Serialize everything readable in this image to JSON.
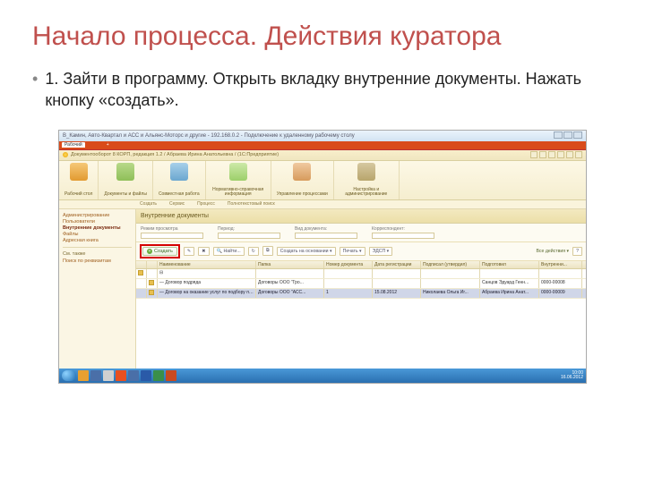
{
  "slide": {
    "title": "Начало процесса. Действия куратора",
    "step": "1. Зайти в программу. Открыть вкладку внутренние документы. Нажать кнопку «создать»."
  },
  "win": {
    "frame_title": "В_Камин, Авто-Квартал и АСС и Альянс-Моторс и другие - 192.168.0.2 - Подключение к удаленному рабочему столу",
    "app_title": "Документооборот 8 КОРП, редакция 1.2 / Абраева Ирина Анатольевна / (1С:Предприятие)",
    "tabs": [
      "Рабочий",
      "",
      "",
      "+"
    ]
  },
  "ribbon": {
    "groups": [
      {
        "label": "Рабочий\nстол"
      },
      {
        "label": "Документы\nи файлы"
      },
      {
        "label": "Совместная\nработа"
      },
      {
        "label": "Нормативно-справочная\nинформация"
      },
      {
        "label": "Управление\nпроцессами"
      },
      {
        "label": "Настройка и\nадминистрирование"
      }
    ],
    "sub": {
      "a": "Создать",
      "b": "Сервис",
      "c": "Процесс",
      "d": "Полнотекстовый поиск"
    }
  },
  "sidebar": {
    "items": [
      "Администрирование",
      "Пользователи",
      "Внутренние документы",
      "Файлы",
      "Адресная книга"
    ],
    "extra": "См. также",
    "search": "Поиск по реквизитам"
  },
  "content": {
    "title": "Внутренние документы",
    "filters": {
      "f1": "Режим просмотра",
      "f2": "Период:",
      "f3": "Вид документа:",
      "f4": "Корреспондент:"
    },
    "toolbar": {
      "create": "Создать",
      "find": "Найти...",
      "basis": "Создать на основании ▾",
      "print": "Печать ▾",
      "edsp": "ЭДСП ▾",
      "all": "Все действия ▾"
    },
    "cols": {
      "c2": "Наименование",
      "c3": "Папка",
      "c4": "Номер документа",
      "c5": "Дата регистрации",
      "c6": "Подписал (утвердил)",
      "c7": "Подготовил",
      "c8": "Внутренни..."
    },
    "rows": [
      {
        "name": "⊟",
        "folder": "",
        "num": "",
        "date": "",
        "sign": "",
        "prep": "",
        "int": ""
      },
      {
        "name": "   — Договор подряда",
        "folder": "Договоры ООО \"Гро...",
        "num": "",
        "date": "",
        "sign": "",
        "prep": "Санцов Эдуард Генн...",
        "int": "0000-00008"
      },
      {
        "name": "   — Договор на оказание услуг по подбору персонала",
        "folder": "Договоры ООО \"АСС...",
        "num": "1",
        "date": "15.08.2012",
        "sign": "Николаева Ольга Иг...",
        "prep": "Абраева Ирина Анат...",
        "int": "0000-00009"
      }
    ]
  },
  "taskbar": {
    "time": "10:00",
    "date": "16.06.2012"
  }
}
